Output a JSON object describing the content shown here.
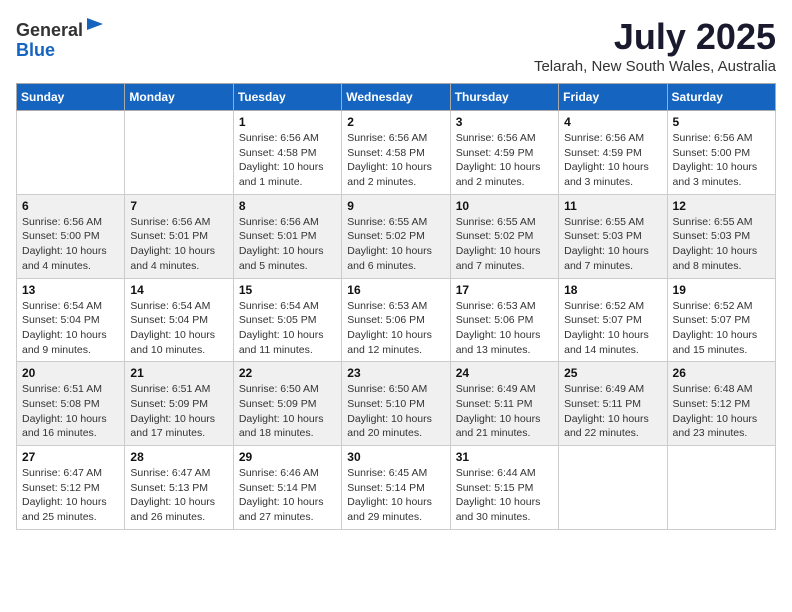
{
  "header": {
    "logo_line1": "General",
    "logo_line2": "Blue",
    "title": "July 2025",
    "subtitle": "Telarah, New South Wales, Australia"
  },
  "calendar": {
    "days_of_week": [
      "Sunday",
      "Monday",
      "Tuesday",
      "Wednesday",
      "Thursday",
      "Friday",
      "Saturday"
    ],
    "weeks": [
      [
        {
          "day": "",
          "detail": ""
        },
        {
          "day": "",
          "detail": ""
        },
        {
          "day": "1",
          "detail": "Sunrise: 6:56 AM\nSunset: 4:58 PM\nDaylight: 10 hours and 1 minute."
        },
        {
          "day": "2",
          "detail": "Sunrise: 6:56 AM\nSunset: 4:58 PM\nDaylight: 10 hours and 2 minutes."
        },
        {
          "day": "3",
          "detail": "Sunrise: 6:56 AM\nSunset: 4:59 PM\nDaylight: 10 hours and 2 minutes."
        },
        {
          "day": "4",
          "detail": "Sunrise: 6:56 AM\nSunset: 4:59 PM\nDaylight: 10 hours and 3 minutes."
        },
        {
          "day": "5",
          "detail": "Sunrise: 6:56 AM\nSunset: 5:00 PM\nDaylight: 10 hours and 3 minutes."
        }
      ],
      [
        {
          "day": "6",
          "detail": "Sunrise: 6:56 AM\nSunset: 5:00 PM\nDaylight: 10 hours and 4 minutes."
        },
        {
          "day": "7",
          "detail": "Sunrise: 6:56 AM\nSunset: 5:01 PM\nDaylight: 10 hours and 4 minutes."
        },
        {
          "day": "8",
          "detail": "Sunrise: 6:56 AM\nSunset: 5:01 PM\nDaylight: 10 hours and 5 minutes."
        },
        {
          "day": "9",
          "detail": "Sunrise: 6:55 AM\nSunset: 5:02 PM\nDaylight: 10 hours and 6 minutes."
        },
        {
          "day": "10",
          "detail": "Sunrise: 6:55 AM\nSunset: 5:02 PM\nDaylight: 10 hours and 7 minutes."
        },
        {
          "day": "11",
          "detail": "Sunrise: 6:55 AM\nSunset: 5:03 PM\nDaylight: 10 hours and 7 minutes."
        },
        {
          "day": "12",
          "detail": "Sunrise: 6:55 AM\nSunset: 5:03 PM\nDaylight: 10 hours and 8 minutes."
        }
      ],
      [
        {
          "day": "13",
          "detail": "Sunrise: 6:54 AM\nSunset: 5:04 PM\nDaylight: 10 hours and 9 minutes."
        },
        {
          "day": "14",
          "detail": "Sunrise: 6:54 AM\nSunset: 5:04 PM\nDaylight: 10 hours and 10 minutes."
        },
        {
          "day": "15",
          "detail": "Sunrise: 6:54 AM\nSunset: 5:05 PM\nDaylight: 10 hours and 11 minutes."
        },
        {
          "day": "16",
          "detail": "Sunrise: 6:53 AM\nSunset: 5:06 PM\nDaylight: 10 hours and 12 minutes."
        },
        {
          "day": "17",
          "detail": "Sunrise: 6:53 AM\nSunset: 5:06 PM\nDaylight: 10 hours and 13 minutes."
        },
        {
          "day": "18",
          "detail": "Sunrise: 6:52 AM\nSunset: 5:07 PM\nDaylight: 10 hours and 14 minutes."
        },
        {
          "day": "19",
          "detail": "Sunrise: 6:52 AM\nSunset: 5:07 PM\nDaylight: 10 hours and 15 minutes."
        }
      ],
      [
        {
          "day": "20",
          "detail": "Sunrise: 6:51 AM\nSunset: 5:08 PM\nDaylight: 10 hours and 16 minutes."
        },
        {
          "day": "21",
          "detail": "Sunrise: 6:51 AM\nSunset: 5:09 PM\nDaylight: 10 hours and 17 minutes."
        },
        {
          "day": "22",
          "detail": "Sunrise: 6:50 AM\nSunset: 5:09 PM\nDaylight: 10 hours and 18 minutes."
        },
        {
          "day": "23",
          "detail": "Sunrise: 6:50 AM\nSunset: 5:10 PM\nDaylight: 10 hours and 20 minutes."
        },
        {
          "day": "24",
          "detail": "Sunrise: 6:49 AM\nSunset: 5:11 PM\nDaylight: 10 hours and 21 minutes."
        },
        {
          "day": "25",
          "detail": "Sunrise: 6:49 AM\nSunset: 5:11 PM\nDaylight: 10 hours and 22 minutes."
        },
        {
          "day": "26",
          "detail": "Sunrise: 6:48 AM\nSunset: 5:12 PM\nDaylight: 10 hours and 23 minutes."
        }
      ],
      [
        {
          "day": "27",
          "detail": "Sunrise: 6:47 AM\nSunset: 5:12 PM\nDaylight: 10 hours and 25 minutes."
        },
        {
          "day": "28",
          "detail": "Sunrise: 6:47 AM\nSunset: 5:13 PM\nDaylight: 10 hours and 26 minutes."
        },
        {
          "day": "29",
          "detail": "Sunrise: 6:46 AM\nSunset: 5:14 PM\nDaylight: 10 hours and 27 minutes."
        },
        {
          "day": "30",
          "detail": "Sunrise: 6:45 AM\nSunset: 5:14 PM\nDaylight: 10 hours and 29 minutes."
        },
        {
          "day": "31",
          "detail": "Sunrise: 6:44 AM\nSunset: 5:15 PM\nDaylight: 10 hours and 30 minutes."
        },
        {
          "day": "",
          "detail": ""
        },
        {
          "day": "",
          "detail": ""
        }
      ]
    ]
  }
}
